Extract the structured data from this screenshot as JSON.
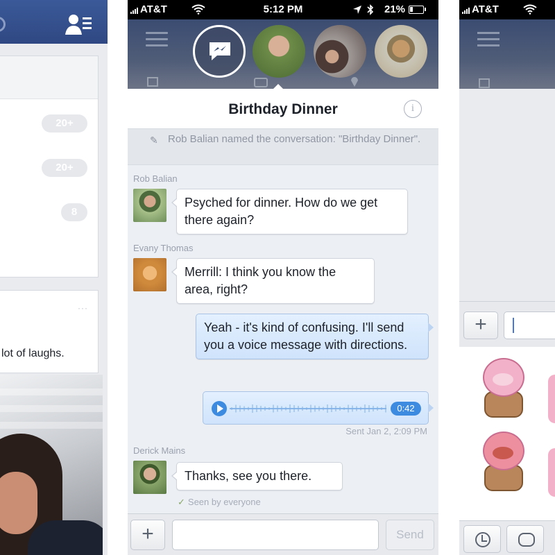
{
  "status_bar": {
    "carrier": "AT&T",
    "time": "5:12 PM",
    "battery": "21%"
  },
  "conversation": {
    "title": "Birthday Dinner",
    "system_message": "Rob Balian named the conversation: \"Birthday Dinner\".",
    "messages": [
      {
        "sender": "Rob Balian",
        "text": "Psyched for dinner. How do we get there again?"
      },
      {
        "sender": "Evany Thomas",
        "text": "Merrill: I think you know the area, right?"
      },
      {
        "sender": "",
        "text": "Yeah - it's kind of confusing. I'll send you a voice message with directions."
      },
      {
        "sender": "Derick Mains",
        "text": "Thanks, see you there."
      }
    ],
    "voice_message": {
      "duration": "0:42",
      "sent_status": "Sent Jan 2, 2:09 PM"
    },
    "seen_status": "Seen by everyone"
  },
  "composer": {
    "plus": "+",
    "placeholder": "",
    "send_label": "Send"
  },
  "left_panel": {
    "counts": [
      "20+",
      "20+",
      "8"
    ],
    "post_text": "lot of laughs.",
    "more": "···"
  },
  "right_panel": {
    "carrier": "AT&T",
    "plus": "+"
  },
  "colors": {
    "facebook_blue": "#3b5998",
    "outgoing_bubble": "#cfe3fb",
    "voice_accent": "#3d8be0",
    "chat_background": "#eceff4"
  }
}
